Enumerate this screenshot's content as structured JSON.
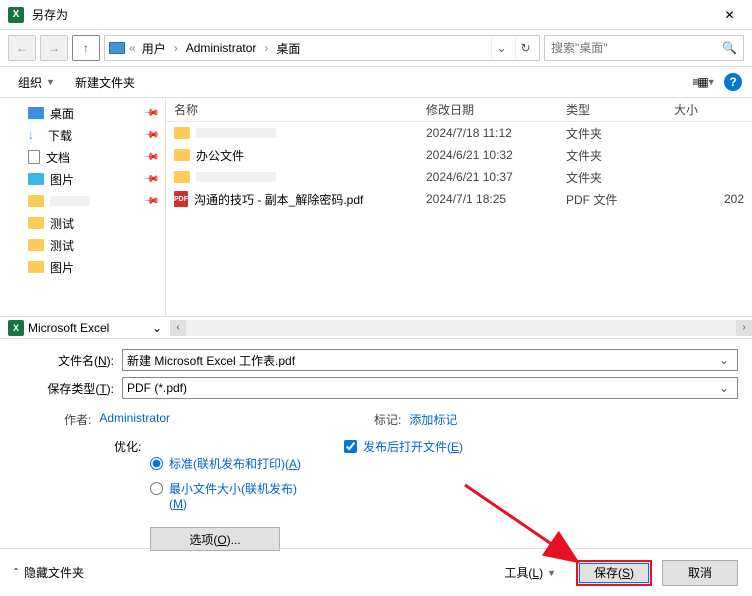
{
  "title": "另存为",
  "app_icon_letter": "X",
  "breadcrumbs": [
    "用户",
    "Administrator",
    "桌面"
  ],
  "search_placeholder": "搜索\"桌面\"",
  "toolbar": {
    "organize": "组织",
    "new_folder": "新建文件夹"
  },
  "sidebar": [
    {
      "icon": "desktop",
      "label": "桌面",
      "pinned": true
    },
    {
      "icon": "download",
      "label": "下载",
      "pinned": true
    },
    {
      "icon": "doc",
      "label": "文档",
      "pinned": true
    },
    {
      "icon": "pic",
      "label": "图片",
      "pinned": true
    },
    {
      "icon": "folder",
      "label": "",
      "pinned": true,
      "redacted": true
    },
    {
      "icon": "folder",
      "label": "测试",
      "pinned": false
    },
    {
      "icon": "folder",
      "label": "测试",
      "pinned": false
    },
    {
      "icon": "folder",
      "label": "图片",
      "pinned": false
    }
  ],
  "excel_label": "Microsoft Excel",
  "columns": {
    "name": "名称",
    "date": "修改日期",
    "type": "类型",
    "size": "大小"
  },
  "files": [
    {
      "icon": "folder",
      "name": "",
      "redacted": true,
      "date": "2024/7/18 11:12",
      "type": "文件夹",
      "size": ""
    },
    {
      "icon": "folder",
      "name": "办公文件",
      "date": "2024/6/21 10:32",
      "type": "文件夹",
      "size": ""
    },
    {
      "icon": "folder",
      "name": "",
      "redacted": true,
      "date": "2024/6/21 10:37",
      "type": "文件夹",
      "size": ""
    },
    {
      "icon": "pdf",
      "name": "沟通的技巧 - 副本_解除密码.pdf",
      "date": "2024/7/1 18:25",
      "type": "PDF 文件",
      "size": "202"
    }
  ],
  "filename_label": "文件名(N):",
  "filename_value": "新建 Microsoft Excel 工作表.pdf",
  "savetype_label": "保存类型(T):",
  "savetype_value": "PDF (*.pdf)",
  "author_label": "作者:",
  "author_value": "Administrator",
  "tags_label": "标记:",
  "tags_value": "添加标记",
  "optimize_label": "优化:",
  "opt_standard": "标准(联机发布和打印)(A)",
  "opt_minimum": "最小文件大小(联机发布)(M)",
  "open_after": "发布后打开文件(E)",
  "options_btn": "选项(O)...",
  "hide_folders": "隐藏文件夹",
  "tools_label": "工具(L)",
  "save_btn": "保存(S)",
  "cancel_btn": "取消"
}
